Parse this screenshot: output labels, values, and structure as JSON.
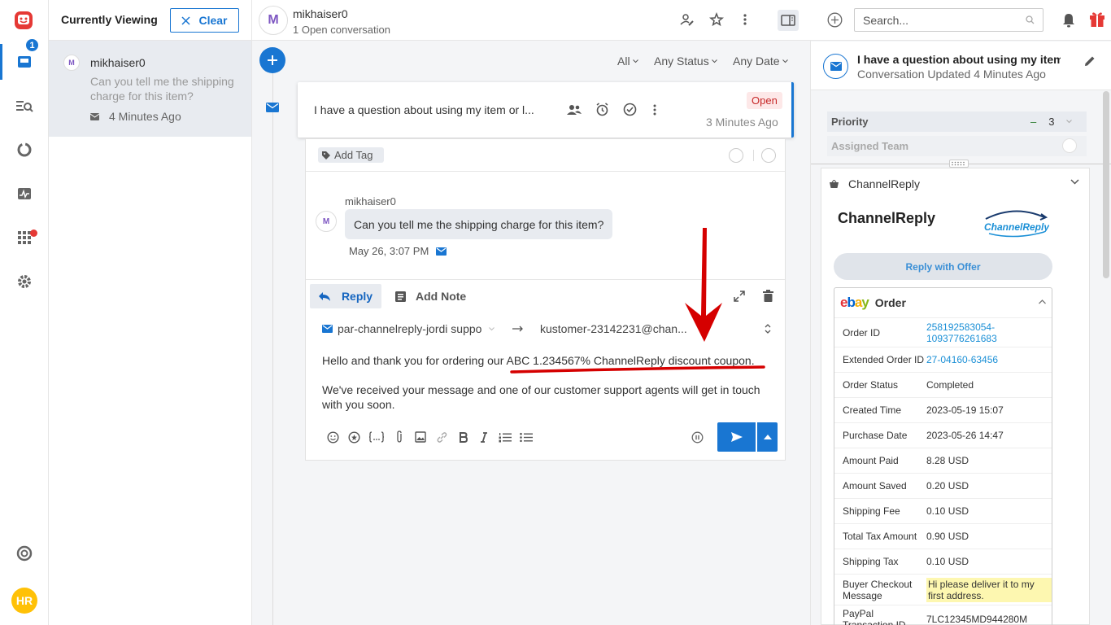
{
  "rail": {
    "notification_count": "1",
    "user_initials": "HR"
  },
  "viewing": {
    "title": "Currently Viewing",
    "clear_label": "Clear",
    "item": {
      "avatar": "M",
      "name": "mikhaiser0",
      "preview": "Can you tell me the shipping charge for this item?",
      "time": "4 Minutes Ago"
    }
  },
  "conversation": {
    "avatar": "M",
    "name": "mikhaiser0",
    "subtitle": "1 Open conversation",
    "filters": [
      "All",
      "Any Status",
      "Any Date"
    ],
    "card": {
      "subject": "I have a question about using my item or l...",
      "status": "Open",
      "since": "3 Minutes Ago"
    },
    "add_tag": "Add Tag",
    "message": {
      "author": "mikhaiser0",
      "avatar": "M",
      "text": "Can you tell me the shipping charge for this item?",
      "time": "May 26, 3:07 PM"
    },
    "composer": {
      "reply_tab": "Reply",
      "note_tab": "Add Note",
      "from": "par-channelreply-jordi suppo",
      "to": "kustomer-23142231@chan...",
      "line1_prefix": "Hello and thank you for ordering our ",
      "line1_highlight": "ABC 1.234567% ChannelReply discount coupon.",
      "line2": "We've received your message and one of our customer support agents will get in touch with you soon."
    }
  },
  "right": {
    "search_placeholder": "Search...",
    "conv_title": "I have a question about using my item ...",
    "conv_updated": "Conversation Updated 4 Minutes Ago",
    "priority_label": "Priority",
    "priority_value": "3",
    "priority_dash": "–",
    "assigned_team_label": "Assigned Team",
    "app_name": "ChannelReply",
    "app_title": "ChannelReply",
    "logo_text": "ChannelReply",
    "reply_offer": "Reply with Offer",
    "order_title": "Order",
    "ebay_letters": [
      "e",
      "b",
      "a",
      "y"
    ],
    "order_rows": [
      {
        "key": "Order ID",
        "value": "258192583054-1093776261683",
        "link": true
      },
      {
        "key": "Extended Order ID",
        "value": "27-04160-63456",
        "link": true
      },
      {
        "key": "Order Status",
        "value": "Completed"
      },
      {
        "key": "Created Time",
        "value": "2023-05-19 15:07"
      },
      {
        "key": "Purchase Date",
        "value": "2023-05-26 14:47"
      },
      {
        "key": "Amount Paid",
        "value": "8.28 USD"
      },
      {
        "key": "Amount Saved",
        "value": "0.20 USD"
      },
      {
        "key": "Shipping Fee",
        "value": "0.10 USD"
      },
      {
        "key": "Total Tax Amount",
        "value": "0.90 USD"
      },
      {
        "key": "Shipping Tax",
        "value": "0.10 USD"
      },
      {
        "key": "Buyer Checkout Message",
        "value": "Hi please deliver it to my first address.",
        "highlight": true
      },
      {
        "key": "PayPal Transaction ID",
        "value": "7LC12345MD944280M"
      }
    ]
  },
  "colors": {
    "accent": "#1976d2",
    "annotation": "#d50000",
    "open_badge": "#c62828",
    "ebay_e": "#e53238",
    "ebay_b": "#0064d2",
    "ebay_a": "#f5af02",
    "ebay_y": "#86b817"
  }
}
